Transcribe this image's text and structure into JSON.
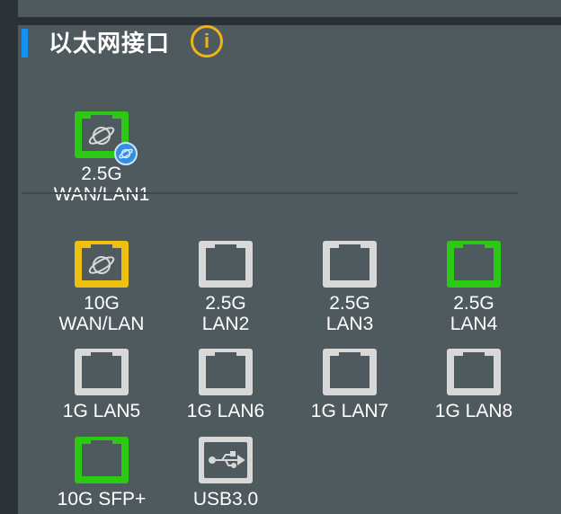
{
  "section": {
    "title": "以太网接口"
  },
  "colors": {
    "connected": "#2bc814",
    "wan_active": "#f0c011",
    "idle": "#d8d8d8",
    "accent": "#1591f2",
    "info": "#f0b515"
  },
  "wan_port": {
    "label_line1": "2.5G",
    "label_line2": "WAN/LAN1",
    "state": "connected",
    "icon": "globe-icon"
  },
  "ports": [
    {
      "label_line1": "10G",
      "label_line2": "WAN/LAN",
      "state": "wan_active",
      "icon": "globe-icon"
    },
    {
      "label_line1": "2.5G",
      "label_line2": "LAN2",
      "state": "idle",
      "icon": "ethernet-port-icon"
    },
    {
      "label_line1": "2.5G",
      "label_line2": "LAN3",
      "state": "idle",
      "icon": "ethernet-port-icon"
    },
    {
      "label_line1": "2.5G",
      "label_line2": "LAN4",
      "state": "connected",
      "icon": "ethernet-port-icon"
    },
    {
      "label_line1": "1G LAN5",
      "label_line2": "",
      "state": "idle",
      "icon": "ethernet-port-icon"
    },
    {
      "label_line1": "1G LAN6",
      "label_line2": "",
      "state": "idle",
      "icon": "ethernet-port-icon"
    },
    {
      "label_line1": "1G LAN7",
      "label_line2": "",
      "state": "idle",
      "icon": "ethernet-port-icon"
    },
    {
      "label_line1": "1G LAN8",
      "label_line2": "",
      "state": "idle",
      "icon": "ethernet-port-icon"
    },
    {
      "label_line1": "10G SFP+",
      "label_line2": "",
      "state": "connected",
      "icon": "sfp-port-icon"
    },
    {
      "label_line1": "USB3.0",
      "label_line2": "",
      "state": "idle",
      "icon": "usb-icon"
    }
  ]
}
